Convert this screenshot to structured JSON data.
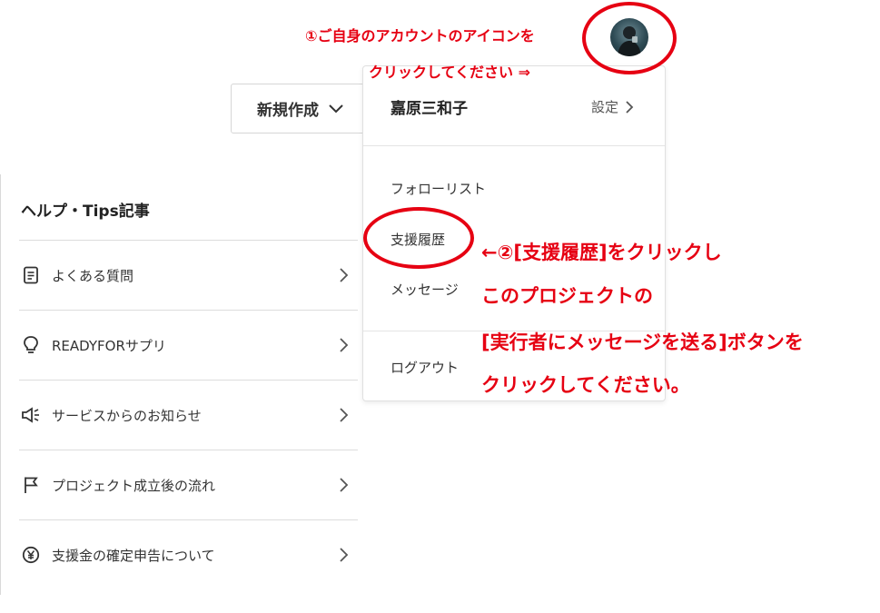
{
  "header": {
    "new_button_label": "新規作成"
  },
  "help": {
    "title": "ヘルプ・Tips記事",
    "items": [
      {
        "label": "よくある質問",
        "icon": "document-icon"
      },
      {
        "label": "READYFORサプリ",
        "icon": "lightbulb-icon"
      },
      {
        "label": "サービスからのお知らせ",
        "icon": "megaphone-icon"
      },
      {
        "label": "プロジェクト成立後の流れ",
        "icon": "flag-icon"
      },
      {
        "label": "支援金の確定申告について",
        "icon": "yen-icon"
      }
    ]
  },
  "dropdown": {
    "user_name": "嘉原三和子",
    "settings_label": "設定",
    "items": [
      {
        "label": "フォローリスト"
      },
      {
        "label": "支援履歴"
      },
      {
        "label": "メッセージ"
      },
      {
        "label": "ログアウト"
      }
    ]
  },
  "annotations": {
    "step1_line1": "①ご自身のアカウントのアイコンを",
    "step1_line2": "クリックしてください ⇒",
    "step2_line1": "←②[支援履歴]をクリックし",
    "step2_line2": "このプロジェクトの",
    "step2_line3": "[実行者にメッセージを送る]ボタンを",
    "step2_line4": "クリックしてください。"
  },
  "colors": {
    "annotation_red": "#e60012",
    "border_gray": "#dcdcdc"
  }
}
